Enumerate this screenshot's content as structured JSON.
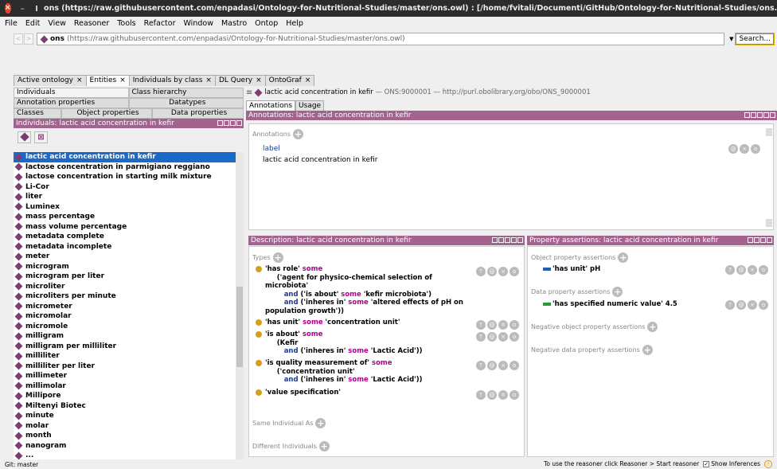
{
  "window": {
    "title": "ons (https://raw.githubusercontent.com/enpadasi/Ontology-for-Nutritional-Studies/master/ons.owl)  : [/home/fvitali/Documenti/GitHub/Ontology-for-Nutritional-Studies/ons.o..."
  },
  "menu": [
    "File",
    "Edit",
    "View",
    "Reasoner",
    "Tools",
    "Refactor",
    "Window",
    "Mastro",
    "Ontop",
    "Help"
  ],
  "address": {
    "name": "ons",
    "url": "(https://raw.githubusercontent.com/enpadasi/Ontology-for-Nutritional-Studies/master/ons.owl)",
    "search": "Search..."
  },
  "tabs": [
    "Active ontology",
    "Entities",
    "Individuals by class",
    "DL Query",
    "OntoGraf"
  ],
  "left": {
    "subtabs1": [
      "Individuals",
      "Class hierarchy",
      "Annotation properties",
      "Datatypes"
    ],
    "subtabs2": [
      "Classes",
      "Object properties",
      "Data properties"
    ],
    "header": "Individuals: lactic acid concentration in kefir",
    "items": [
      "lactic acid concentration in kefir",
      "lactose concentration in parmigiano reggiano",
      "lactose concentration in starting milk mixture",
      "Li-Cor",
      "liter",
      "Luminex",
      "mass percentage",
      "mass volume percentage",
      "metadata complete",
      "metadata incomplete",
      "meter",
      "microgram",
      "microgram per liter",
      "microliter",
      "microliters per minute",
      "micrometer",
      "micromolar",
      "micromole",
      "milligram",
      "milligram per milliliter",
      "milliliter",
      "milliliter per liter",
      "millimeter",
      "millimolar",
      "Millipore",
      "Miltenyi Biotec",
      "minute",
      "molar",
      "month",
      "nanogram",
      "..."
    ]
  },
  "entity": {
    "name": "lactic acid concentration in kefir",
    "iri": "— ONS:9000001 — http://purl.obolibrary.org/obo/ONS_9000001"
  },
  "annotabs": [
    "Annotations",
    "Usage"
  ],
  "annotations": {
    "header": "Annotations: lactic acid concentration in kefir",
    "label": "Annotations",
    "prop": "label",
    "value": "lactic acid concentration in kefir"
  },
  "description": {
    "header": "Description: lactic acid concentration in kefir",
    "types": "Types",
    "same": "Same Individual As",
    "different": "Different Individuals"
  },
  "props": {
    "header": "Property assertions: lactic acid concentration in kefir",
    "obj": "Object property assertions",
    "objval": "'has unit'  pH",
    "data": "Data property assertions",
    "dataval": "'has specified numeric value'  4.5",
    "negobj": "Negative object property assertions",
    "negdata": "Negative data property assertions"
  },
  "status": {
    "left": "Git: master",
    "right": "To use the reasoner click Reasoner > Start reasoner",
    "show": "Show Inferences"
  }
}
